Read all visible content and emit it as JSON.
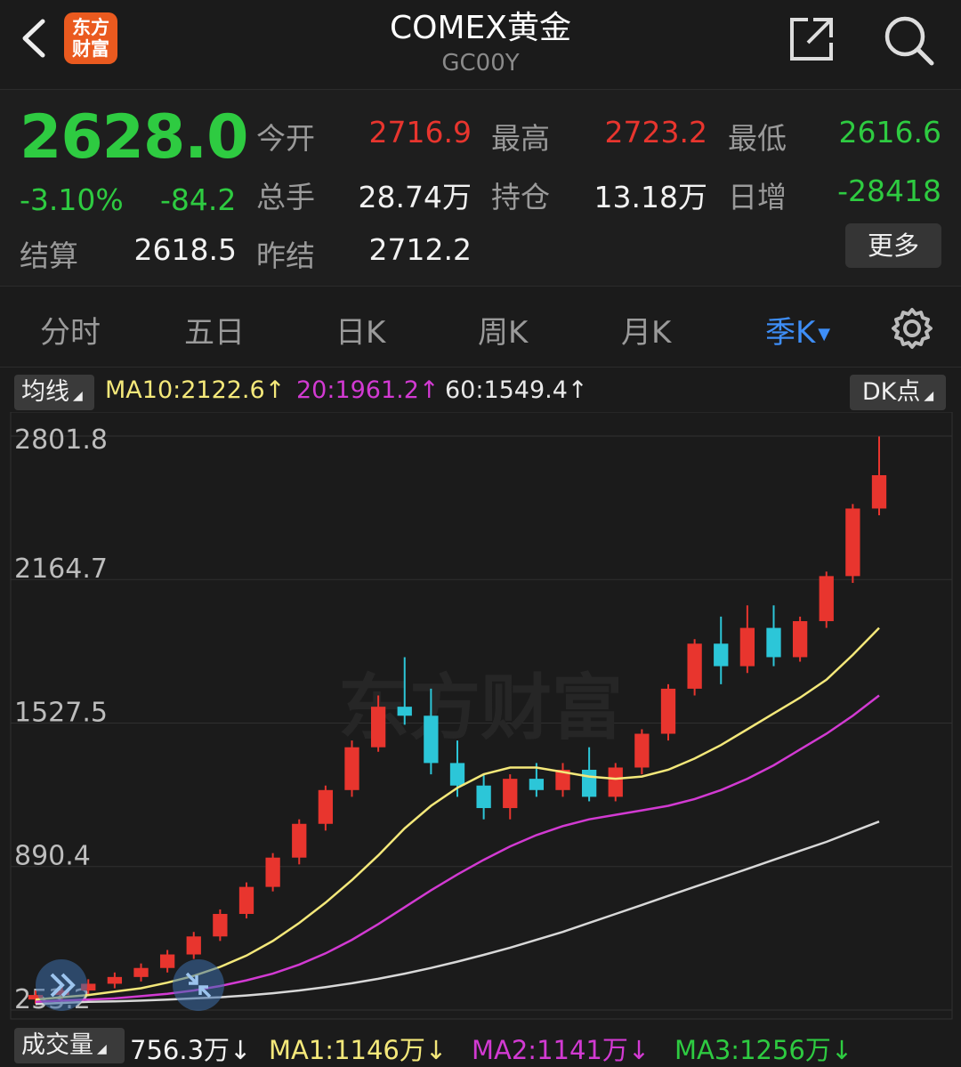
{
  "header": {
    "title": "COMEX黄金",
    "code": "GC00Y",
    "logo_text_1": "东方",
    "logo_text_2": "财富"
  },
  "quote": {
    "price": "2628.0",
    "change_pct": "-3.10%",
    "change": "-84.2",
    "open_label": "今开",
    "open": "2716.9",
    "high_label": "最高",
    "high": "2723.2",
    "low_label": "最低",
    "low": "2616.6",
    "volume_label": "总手",
    "volume": "28.74万",
    "oi_label": "持仓",
    "oi": "13.18万",
    "daily_inc_label": "日增",
    "daily_inc": "-28418",
    "settle_label": "结算",
    "settle": "2618.5",
    "prev_settle_label": "昨结",
    "prev_settle": "2712.2",
    "more_label": "更多"
  },
  "tabs": [
    {
      "label": "分时"
    },
    {
      "label": "五日"
    },
    {
      "label": "日K"
    },
    {
      "label": "周K"
    },
    {
      "label": "月K"
    },
    {
      "label": "季K"
    }
  ],
  "indicators": {
    "ma_selector": "均线",
    "ma10": "MA10:2122.6↑",
    "ma20": "20:1961.2↑",
    "ma60": "60:1549.4↑",
    "dk": "DK点",
    "volume_selector": "成交量",
    "vol_value": "756.3万↓",
    "vol_ma1": "MA1:1146万↓",
    "vol_ma2": "MA2:1141万↓",
    "vol_ma3": "MA3:1256万↓"
  },
  "colors": {
    "up": "#e8352e",
    "down": "#2cc6d8",
    "ma10": "#f4e87a",
    "ma20": "#d23ad2",
    "ma60": "#d8d8d8",
    "active_tab": "#3e8ef7"
  },
  "chart_data": {
    "type": "candlestick",
    "y_ticks": [
      "2801.8",
      "2164.7",
      "1527.5",
      "890.4",
      "253.2"
    ],
    "ylim": [
      253.2,
      2801.8
    ],
    "ohlc": [
      [
        300,
        340,
        280,
        320
      ],
      [
        320,
        360,
        300,
        340
      ],
      [
        340,
        390,
        320,
        370
      ],
      [
        370,
        420,
        350,
        400
      ],
      [
        400,
        460,
        380,
        440
      ],
      [
        440,
        520,
        420,
        500
      ],
      [
        500,
        600,
        480,
        580
      ],
      [
        580,
        700,
        560,
        680
      ],
      [
        680,
        820,
        660,
        800
      ],
      [
        800,
        950,
        780,
        930
      ],
      [
        930,
        1100,
        900,
        1080
      ],
      [
        1080,
        1250,
        1050,
        1230
      ],
      [
        1230,
        1450,
        1200,
        1420
      ],
      [
        1420,
        1650,
        1400,
        1600
      ],
      [
        1600,
        1820,
        1520,
        1560
      ],
      [
        1560,
        1680,
        1300,
        1350
      ],
      [
        1350,
        1450,
        1200,
        1250
      ],
      [
        1250,
        1300,
        1100,
        1150
      ],
      [
        1150,
        1300,
        1100,
        1280
      ],
      [
        1280,
        1350,
        1200,
        1230
      ],
      [
        1230,
        1350,
        1200,
        1320
      ],
      [
        1320,
        1420,
        1180,
        1200
      ],
      [
        1200,
        1350,
        1180,
        1330
      ],
      [
        1330,
        1500,
        1300,
        1480
      ],
      [
        1480,
        1700,
        1450,
        1680
      ],
      [
        1680,
        1900,
        1650,
        1880
      ],
      [
        1880,
        2000,
        1700,
        1780
      ],
      [
        1780,
        2050,
        1750,
        1950
      ],
      [
        1950,
        2050,
        1780,
        1820
      ],
      [
        1820,
        2000,
        1800,
        1980
      ],
      [
        1980,
        2200,
        1950,
        2180
      ],
      [
        2180,
        2500,
        2150,
        2480
      ],
      [
        2480,
        2800,
        2450,
        2628
      ]
    ],
    "ma10": [
      300,
      310,
      320,
      335,
      350,
      375,
      405,
      445,
      495,
      560,
      640,
      730,
      830,
      940,
      1060,
      1160,
      1240,
      1300,
      1330,
      1330,
      1310,
      1290,
      1280,
      1290,
      1320,
      1370,
      1430,
      1500,
      1570,
      1640,
      1720,
      1830,
      1950
    ],
    "ma20": [
      290,
      295,
      300,
      305,
      315,
      325,
      340,
      360,
      385,
      415,
      455,
      505,
      565,
      635,
      710,
      785,
      855,
      920,
      980,
      1030,
      1070,
      1100,
      1120,
      1140,
      1160,
      1190,
      1230,
      1280,
      1340,
      1410,
      1480,
      1560,
      1650
    ],
    "ma60": [
      280,
      285,
      290,
      292,
      295,
      300,
      305,
      310,
      318,
      328,
      340,
      355,
      372,
      392,
      415,
      440,
      468,
      498,
      530,
      565,
      600,
      640,
      680,
      720,
      760,
      800,
      840,
      880,
      920,
      960,
      1000,
      1045,
      1090
    ]
  }
}
